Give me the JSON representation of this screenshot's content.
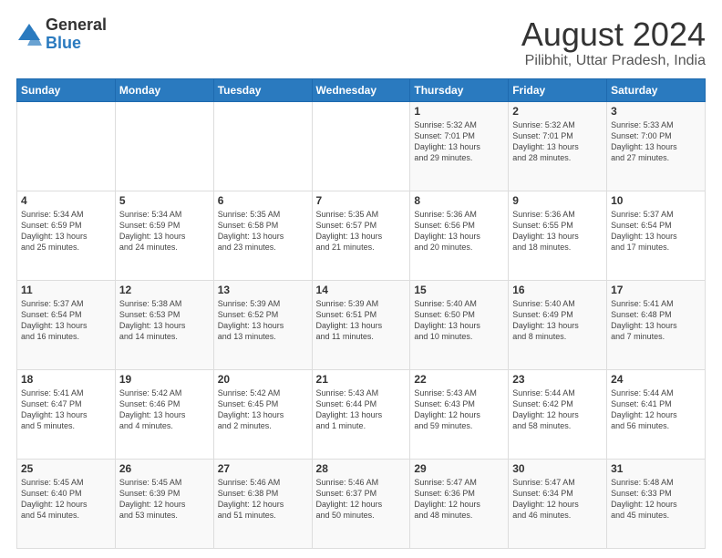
{
  "header": {
    "logo_general": "General",
    "logo_blue": "Blue",
    "title": "August 2024",
    "location": "Pilibhit, Uttar Pradesh, India"
  },
  "days_of_week": [
    "Sunday",
    "Monday",
    "Tuesday",
    "Wednesday",
    "Thursday",
    "Friday",
    "Saturday"
  ],
  "weeks": [
    [
      {
        "day": "",
        "info": ""
      },
      {
        "day": "",
        "info": ""
      },
      {
        "day": "",
        "info": ""
      },
      {
        "day": "",
        "info": ""
      },
      {
        "day": "1",
        "info": "Sunrise: 5:32 AM\nSunset: 7:01 PM\nDaylight: 13 hours\nand 29 minutes."
      },
      {
        "day": "2",
        "info": "Sunrise: 5:32 AM\nSunset: 7:01 PM\nDaylight: 13 hours\nand 28 minutes."
      },
      {
        "day": "3",
        "info": "Sunrise: 5:33 AM\nSunset: 7:00 PM\nDaylight: 13 hours\nand 27 minutes."
      }
    ],
    [
      {
        "day": "4",
        "info": "Sunrise: 5:34 AM\nSunset: 6:59 PM\nDaylight: 13 hours\nand 25 minutes."
      },
      {
        "day": "5",
        "info": "Sunrise: 5:34 AM\nSunset: 6:59 PM\nDaylight: 13 hours\nand 24 minutes."
      },
      {
        "day": "6",
        "info": "Sunrise: 5:35 AM\nSunset: 6:58 PM\nDaylight: 13 hours\nand 23 minutes."
      },
      {
        "day": "7",
        "info": "Sunrise: 5:35 AM\nSunset: 6:57 PM\nDaylight: 13 hours\nand 21 minutes."
      },
      {
        "day": "8",
        "info": "Sunrise: 5:36 AM\nSunset: 6:56 PM\nDaylight: 13 hours\nand 20 minutes."
      },
      {
        "day": "9",
        "info": "Sunrise: 5:36 AM\nSunset: 6:55 PM\nDaylight: 13 hours\nand 18 minutes."
      },
      {
        "day": "10",
        "info": "Sunrise: 5:37 AM\nSunset: 6:54 PM\nDaylight: 13 hours\nand 17 minutes."
      }
    ],
    [
      {
        "day": "11",
        "info": "Sunrise: 5:37 AM\nSunset: 6:54 PM\nDaylight: 13 hours\nand 16 minutes."
      },
      {
        "day": "12",
        "info": "Sunrise: 5:38 AM\nSunset: 6:53 PM\nDaylight: 13 hours\nand 14 minutes."
      },
      {
        "day": "13",
        "info": "Sunrise: 5:39 AM\nSunset: 6:52 PM\nDaylight: 13 hours\nand 13 minutes."
      },
      {
        "day": "14",
        "info": "Sunrise: 5:39 AM\nSunset: 6:51 PM\nDaylight: 13 hours\nand 11 minutes."
      },
      {
        "day": "15",
        "info": "Sunrise: 5:40 AM\nSunset: 6:50 PM\nDaylight: 13 hours\nand 10 minutes."
      },
      {
        "day": "16",
        "info": "Sunrise: 5:40 AM\nSunset: 6:49 PM\nDaylight: 13 hours\nand 8 minutes."
      },
      {
        "day": "17",
        "info": "Sunrise: 5:41 AM\nSunset: 6:48 PM\nDaylight: 13 hours\nand 7 minutes."
      }
    ],
    [
      {
        "day": "18",
        "info": "Sunrise: 5:41 AM\nSunset: 6:47 PM\nDaylight: 13 hours\nand 5 minutes."
      },
      {
        "day": "19",
        "info": "Sunrise: 5:42 AM\nSunset: 6:46 PM\nDaylight: 13 hours\nand 4 minutes."
      },
      {
        "day": "20",
        "info": "Sunrise: 5:42 AM\nSunset: 6:45 PM\nDaylight: 13 hours\nand 2 minutes."
      },
      {
        "day": "21",
        "info": "Sunrise: 5:43 AM\nSunset: 6:44 PM\nDaylight: 13 hours\nand 1 minute."
      },
      {
        "day": "22",
        "info": "Sunrise: 5:43 AM\nSunset: 6:43 PM\nDaylight: 12 hours\nand 59 minutes."
      },
      {
        "day": "23",
        "info": "Sunrise: 5:44 AM\nSunset: 6:42 PM\nDaylight: 12 hours\nand 58 minutes."
      },
      {
        "day": "24",
        "info": "Sunrise: 5:44 AM\nSunset: 6:41 PM\nDaylight: 12 hours\nand 56 minutes."
      }
    ],
    [
      {
        "day": "25",
        "info": "Sunrise: 5:45 AM\nSunset: 6:40 PM\nDaylight: 12 hours\nand 54 minutes."
      },
      {
        "day": "26",
        "info": "Sunrise: 5:45 AM\nSunset: 6:39 PM\nDaylight: 12 hours\nand 53 minutes."
      },
      {
        "day": "27",
        "info": "Sunrise: 5:46 AM\nSunset: 6:38 PM\nDaylight: 12 hours\nand 51 minutes."
      },
      {
        "day": "28",
        "info": "Sunrise: 5:46 AM\nSunset: 6:37 PM\nDaylight: 12 hours\nand 50 minutes."
      },
      {
        "day": "29",
        "info": "Sunrise: 5:47 AM\nSunset: 6:36 PM\nDaylight: 12 hours\nand 48 minutes."
      },
      {
        "day": "30",
        "info": "Sunrise: 5:47 AM\nSunset: 6:34 PM\nDaylight: 12 hours\nand 46 minutes."
      },
      {
        "day": "31",
        "info": "Sunrise: 5:48 AM\nSunset: 6:33 PM\nDaylight: 12 hours\nand 45 minutes."
      }
    ]
  ]
}
